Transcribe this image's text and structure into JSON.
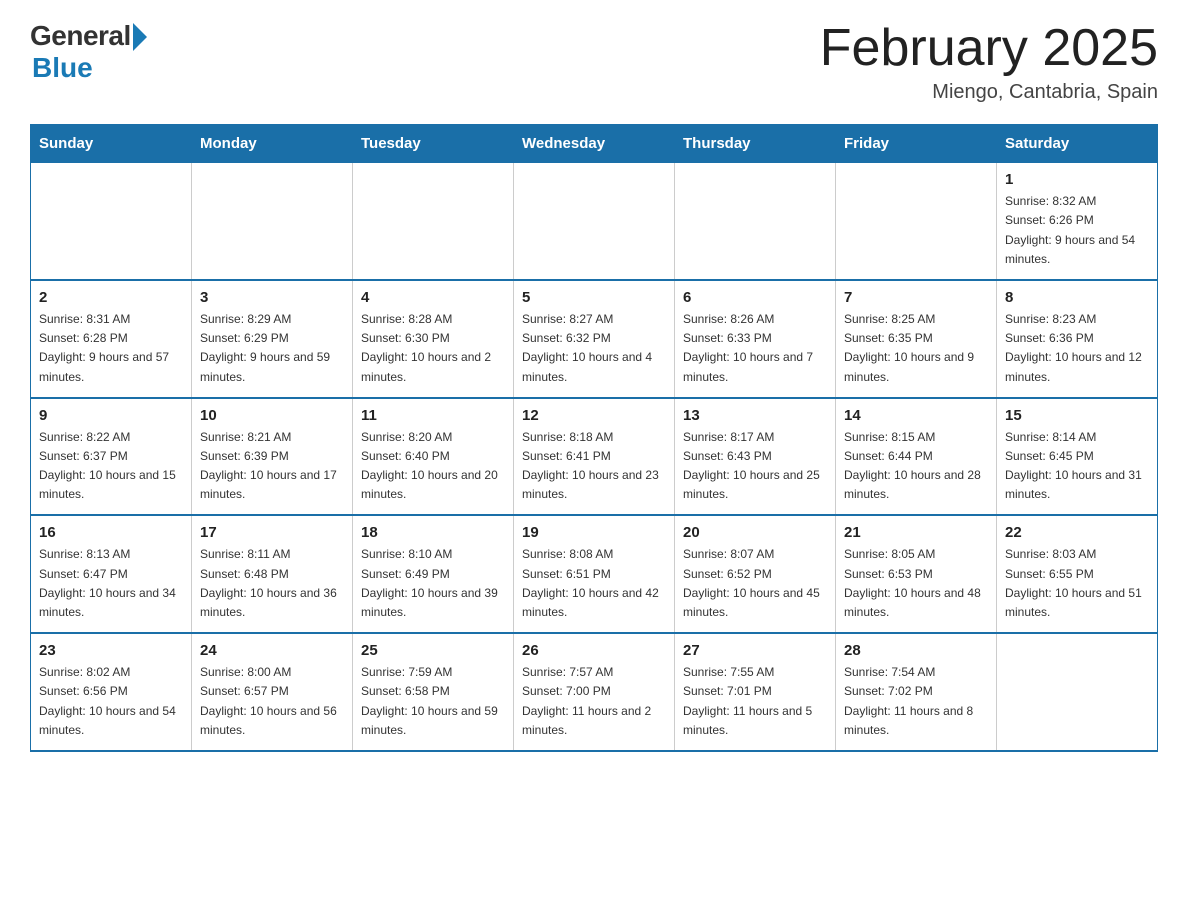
{
  "header": {
    "logo_general": "General",
    "logo_blue": "Blue",
    "title": "February 2025",
    "subtitle": "Miengo, Cantabria, Spain"
  },
  "weekdays": [
    "Sunday",
    "Monday",
    "Tuesday",
    "Wednesday",
    "Thursday",
    "Friday",
    "Saturday"
  ],
  "rows": [
    [
      {
        "day": "",
        "empty": true
      },
      {
        "day": "",
        "empty": true
      },
      {
        "day": "",
        "empty": true
      },
      {
        "day": "",
        "empty": true
      },
      {
        "day": "",
        "empty": true
      },
      {
        "day": "",
        "empty": true
      },
      {
        "day": "1",
        "sunrise": "8:32 AM",
        "sunset": "6:26 PM",
        "daylight": "9 hours and 54 minutes."
      }
    ],
    [
      {
        "day": "2",
        "sunrise": "8:31 AM",
        "sunset": "6:28 PM",
        "daylight": "9 hours and 57 minutes."
      },
      {
        "day": "3",
        "sunrise": "8:29 AM",
        "sunset": "6:29 PM",
        "daylight": "9 hours and 59 minutes."
      },
      {
        "day": "4",
        "sunrise": "8:28 AM",
        "sunset": "6:30 PM",
        "daylight": "10 hours and 2 minutes."
      },
      {
        "day": "5",
        "sunrise": "8:27 AM",
        "sunset": "6:32 PM",
        "daylight": "10 hours and 4 minutes."
      },
      {
        "day": "6",
        "sunrise": "8:26 AM",
        "sunset": "6:33 PM",
        "daylight": "10 hours and 7 minutes."
      },
      {
        "day": "7",
        "sunrise": "8:25 AM",
        "sunset": "6:35 PM",
        "daylight": "10 hours and 9 minutes."
      },
      {
        "day": "8",
        "sunrise": "8:23 AM",
        "sunset": "6:36 PM",
        "daylight": "10 hours and 12 minutes."
      }
    ],
    [
      {
        "day": "9",
        "sunrise": "8:22 AM",
        "sunset": "6:37 PM",
        "daylight": "10 hours and 15 minutes."
      },
      {
        "day": "10",
        "sunrise": "8:21 AM",
        "sunset": "6:39 PM",
        "daylight": "10 hours and 17 minutes."
      },
      {
        "day": "11",
        "sunrise": "8:20 AM",
        "sunset": "6:40 PM",
        "daylight": "10 hours and 20 minutes."
      },
      {
        "day": "12",
        "sunrise": "8:18 AM",
        "sunset": "6:41 PM",
        "daylight": "10 hours and 23 minutes."
      },
      {
        "day": "13",
        "sunrise": "8:17 AM",
        "sunset": "6:43 PM",
        "daylight": "10 hours and 25 minutes."
      },
      {
        "day": "14",
        "sunrise": "8:15 AM",
        "sunset": "6:44 PM",
        "daylight": "10 hours and 28 minutes."
      },
      {
        "day": "15",
        "sunrise": "8:14 AM",
        "sunset": "6:45 PM",
        "daylight": "10 hours and 31 minutes."
      }
    ],
    [
      {
        "day": "16",
        "sunrise": "8:13 AM",
        "sunset": "6:47 PM",
        "daylight": "10 hours and 34 minutes."
      },
      {
        "day": "17",
        "sunrise": "8:11 AM",
        "sunset": "6:48 PM",
        "daylight": "10 hours and 36 minutes."
      },
      {
        "day": "18",
        "sunrise": "8:10 AM",
        "sunset": "6:49 PM",
        "daylight": "10 hours and 39 minutes."
      },
      {
        "day": "19",
        "sunrise": "8:08 AM",
        "sunset": "6:51 PM",
        "daylight": "10 hours and 42 minutes."
      },
      {
        "day": "20",
        "sunrise": "8:07 AM",
        "sunset": "6:52 PM",
        "daylight": "10 hours and 45 minutes."
      },
      {
        "day": "21",
        "sunrise": "8:05 AM",
        "sunset": "6:53 PM",
        "daylight": "10 hours and 48 minutes."
      },
      {
        "day": "22",
        "sunrise": "8:03 AM",
        "sunset": "6:55 PM",
        "daylight": "10 hours and 51 minutes."
      }
    ],
    [
      {
        "day": "23",
        "sunrise": "8:02 AM",
        "sunset": "6:56 PM",
        "daylight": "10 hours and 54 minutes."
      },
      {
        "day": "24",
        "sunrise": "8:00 AM",
        "sunset": "6:57 PM",
        "daylight": "10 hours and 56 minutes."
      },
      {
        "day": "25",
        "sunrise": "7:59 AM",
        "sunset": "6:58 PM",
        "daylight": "10 hours and 59 minutes."
      },
      {
        "day": "26",
        "sunrise": "7:57 AM",
        "sunset": "7:00 PM",
        "daylight": "11 hours and 2 minutes."
      },
      {
        "day": "27",
        "sunrise": "7:55 AM",
        "sunset": "7:01 PM",
        "daylight": "11 hours and 5 minutes."
      },
      {
        "day": "28",
        "sunrise": "7:54 AM",
        "sunset": "7:02 PM",
        "daylight": "11 hours and 8 minutes."
      },
      {
        "day": "",
        "empty": true
      }
    ]
  ]
}
